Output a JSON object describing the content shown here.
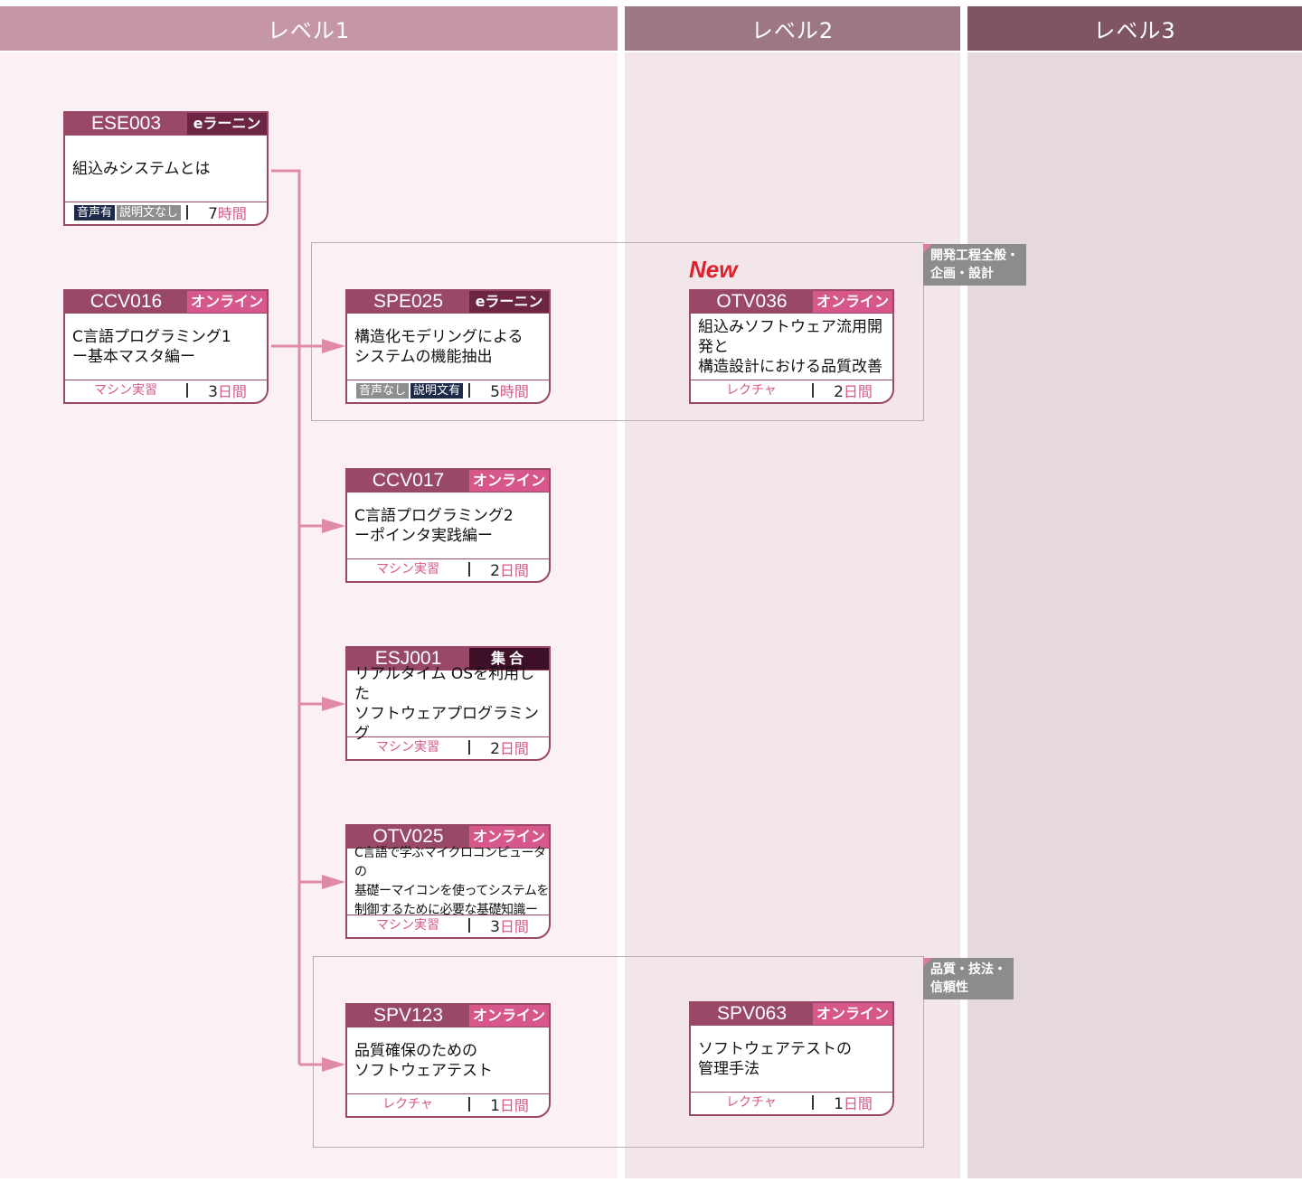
{
  "levels": [
    "レベル1",
    "レベル2",
    "レベル3"
  ],
  "groups": [
    {
      "label_line1": "開発工程全般・",
      "label_line2": "企画・設計"
    },
    {
      "label_line1": "品質・技法・",
      "label_line2": "信頼性"
    }
  ],
  "new_badge": "New",
  "courses": [
    {
      "code": "ESE003",
      "format": "eラーニング",
      "title1": "組込みシステムとは",
      "title2": "",
      "title3": "",
      "audio1": "音声有",
      "audio2": "説明文なし",
      "duration": "7",
      "unit": "時間"
    },
    {
      "code": "CCV016",
      "format": "オンライン",
      "title1": "C言語プログラミング1",
      "title2": "ー基本マスタ編ー",
      "title3": "",
      "type": "マシン実習",
      "duration": "3",
      "unit": "日間"
    },
    {
      "code": "SPE025",
      "format": "eラーニング",
      "title1": "構造化モデリングによる",
      "title2": "システムの機能抽出",
      "title3": "",
      "audio1": "音声なし",
      "audio2": "説明文有",
      "duration": "5",
      "unit": "時間"
    },
    {
      "code": "OTV036",
      "format": "オンライン",
      "title1": "組込みソフトウェア流用開発と",
      "title2": "構造設計における品質改善",
      "title3": "",
      "type": "レクチャ",
      "duration": "2",
      "unit": "日間"
    },
    {
      "code": "CCV017",
      "format": "オンライン",
      "title1": "C言語プログラミング2",
      "title2": "ーポインタ実践編ー",
      "title3": "",
      "type": "マシン実習",
      "duration": "2",
      "unit": "日間"
    },
    {
      "code": "ESJ001",
      "format": "集合",
      "title1": "リアルタイム OSを利用した",
      "title2": "ソフトウェアプログラミング",
      "title3": "",
      "type": "マシン実習",
      "duration": "2",
      "unit": "日間"
    },
    {
      "code": "OTV025",
      "format": "オンライン",
      "title1": "C言語で学ぶマイクロコンピュータの",
      "title2": "基礎ーマイコンを使ってシステムを",
      "title3": "制御するために必要な基礎知識ー",
      "type": "マシン実習",
      "duration": "3",
      "unit": "日間"
    },
    {
      "code": "SPV123",
      "format": "オンライン",
      "title1": "品質確保のための",
      "title2": "ソフトウェアテスト",
      "title3": "",
      "type": "レクチャ",
      "duration": "1",
      "unit": "日間"
    },
    {
      "code": "SPV063",
      "format": "オンライン",
      "title1": "ソフトウェアテストの",
      "title2": "管理手法",
      "title3": "",
      "type": "レクチャ",
      "duration": "1",
      "unit": "日間"
    }
  ],
  "colors": {
    "level1": "#c496a8",
    "level2": "#9e7786",
    "level3": "#7f5566",
    "arrow": "#e08aa8",
    "accent": "#d6578a"
  }
}
